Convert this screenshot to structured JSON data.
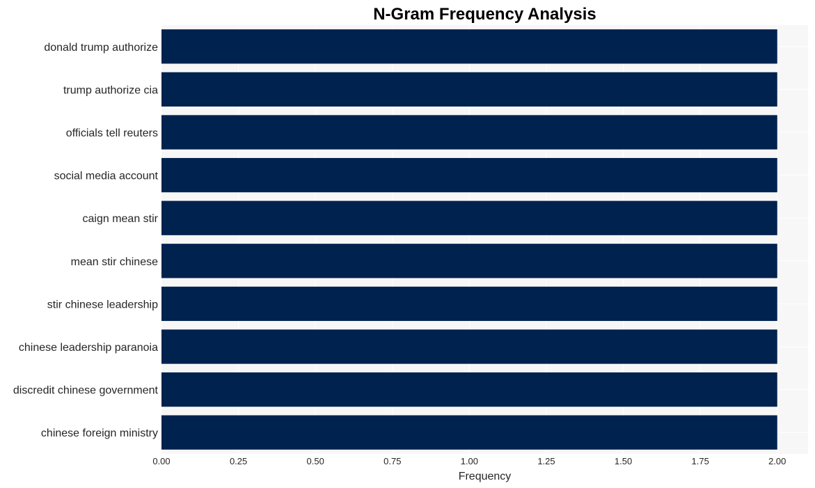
{
  "chart_data": {
    "type": "bar",
    "orientation": "horizontal",
    "title": "N-Gram Frequency Analysis",
    "xlabel": "Frequency",
    "ylabel": "",
    "categories": [
      "donald trump authorize",
      "trump authorize cia",
      "officials tell reuters",
      "social media account",
      "caign mean stir",
      "mean stir chinese",
      "stir chinese leadership",
      "chinese leadership paranoia",
      "discredit chinese government",
      "chinese foreign ministry"
    ],
    "values": [
      2,
      2,
      2,
      2,
      2,
      2,
      2,
      2,
      2,
      2
    ],
    "xlim": [
      0,
      2.1
    ],
    "xticks": [
      0.0,
      0.25,
      0.5,
      0.75,
      1.0,
      1.25,
      1.5,
      1.75,
      2.0
    ],
    "xtick_labels": [
      "0.00",
      "0.25",
      "0.50",
      "0.75",
      "1.00",
      "1.25",
      "1.50",
      "1.75",
      "2.00"
    ],
    "grid": true,
    "legend": "none",
    "colors": {
      "bar": "#00224e",
      "plot_background": "#f7f7f7",
      "grid": "#ffffff"
    }
  }
}
